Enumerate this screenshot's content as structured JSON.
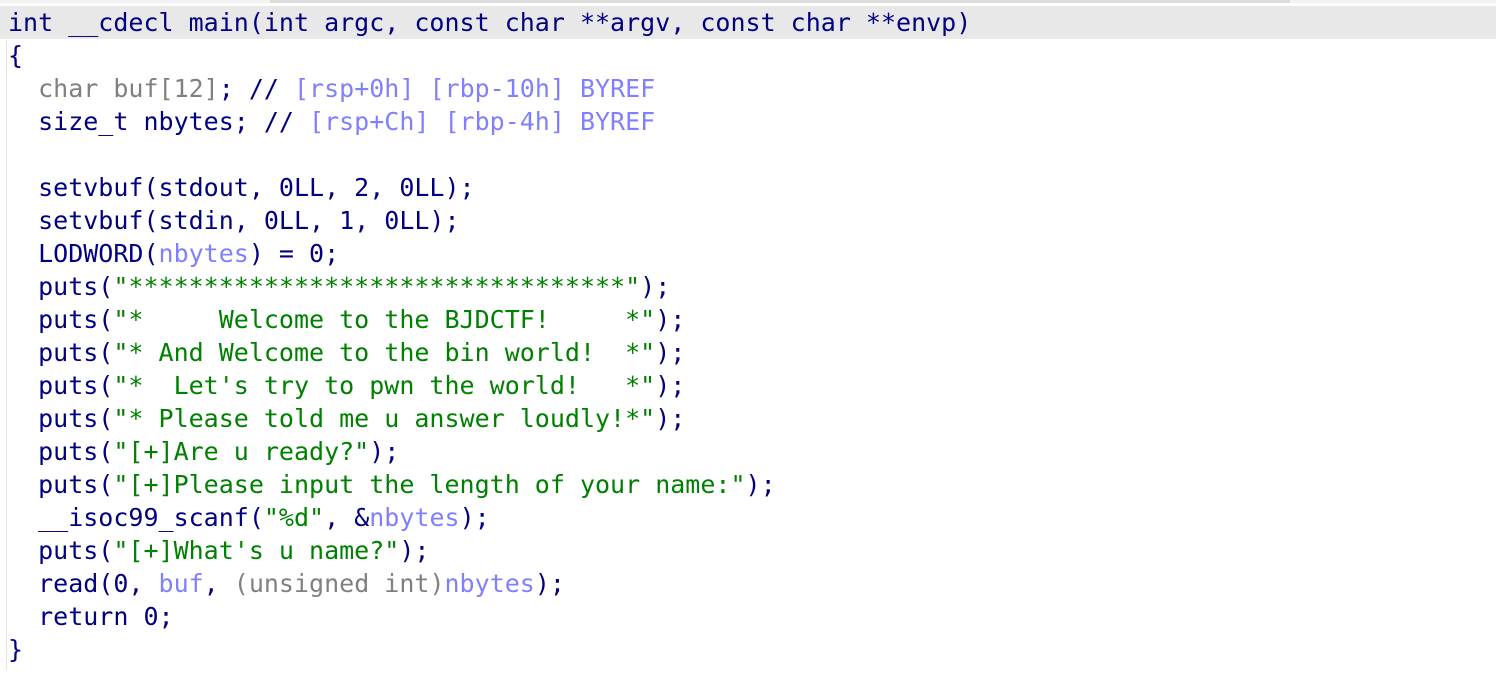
{
  "colors": {
    "identifier": "#000080",
    "comment_dim": "#808080",
    "variable": "#8080ff",
    "string": "#008000",
    "highlight_bg": "#e8e8e8"
  },
  "code_lines": [
    {
      "highlight": true,
      "tokens": [
        {
          "t": "int __cdecl main(int argc, const char **argv, const char **envp)",
          "c": "id"
        }
      ]
    },
    {
      "tokens": [
        {
          "t": "{",
          "c": "id"
        }
      ]
    },
    {
      "tokens": [
        {
          "t": "  char buf",
          "c": "dim"
        },
        {
          "t": "[12]",
          "c": "dim"
        },
        {
          "t": "; // ",
          "c": "id"
        },
        {
          "t": "[rsp+0h] [rbp-10h] BYREF",
          "c": "var"
        }
      ]
    },
    {
      "tokens": [
        {
          "t": "  size_t nbytes; // ",
          "c": "id"
        },
        {
          "t": "[rsp+Ch] [rbp-4h] BYREF",
          "c": "var"
        }
      ]
    },
    {
      "tokens": [
        {
          "t": "",
          "c": "id"
        }
      ]
    },
    {
      "tokens": [
        {
          "t": "  setvbuf(stdout, 0LL, 2, 0LL);",
          "c": "id"
        }
      ]
    },
    {
      "tokens": [
        {
          "t": "  setvbuf(stdin, 0LL, 1, 0LL);",
          "c": "id"
        }
      ]
    },
    {
      "tokens": [
        {
          "t": "  LODWORD(",
          "c": "id"
        },
        {
          "t": "nbytes",
          "c": "var"
        },
        {
          "t": ") = 0;",
          "c": "id"
        }
      ]
    },
    {
      "tokens": [
        {
          "t": "  puts(",
          "c": "id"
        },
        {
          "t": "\"*********************************\"",
          "c": "str"
        },
        {
          "t": ");",
          "c": "id"
        }
      ]
    },
    {
      "tokens": [
        {
          "t": "  puts(",
          "c": "id"
        },
        {
          "t": "\"*     Welcome to the BJDCTF!     *\"",
          "c": "str"
        },
        {
          "t": ");",
          "c": "id"
        }
      ]
    },
    {
      "tokens": [
        {
          "t": "  puts(",
          "c": "id"
        },
        {
          "t": "\"* And Welcome to the bin world!  *\"",
          "c": "str"
        },
        {
          "t": ");",
          "c": "id"
        }
      ]
    },
    {
      "tokens": [
        {
          "t": "  puts(",
          "c": "id"
        },
        {
          "t": "\"*  Let's try to pwn the world!   *\"",
          "c": "str"
        },
        {
          "t": ");",
          "c": "id"
        }
      ]
    },
    {
      "tokens": [
        {
          "t": "  puts(",
          "c": "id"
        },
        {
          "t": "\"* Please told me u answer loudly!*\"",
          "c": "str"
        },
        {
          "t": ");",
          "c": "id"
        }
      ]
    },
    {
      "tokens": [
        {
          "t": "  puts(",
          "c": "id"
        },
        {
          "t": "\"[+]Are u ready?\"",
          "c": "str"
        },
        {
          "t": ");",
          "c": "id"
        }
      ]
    },
    {
      "tokens": [
        {
          "t": "  puts(",
          "c": "id"
        },
        {
          "t": "\"[+]Please input the length of your name:\"",
          "c": "str"
        },
        {
          "t": ");",
          "c": "id"
        }
      ]
    },
    {
      "tokens": [
        {
          "t": "  __isoc99_scanf(",
          "c": "id"
        },
        {
          "t": "\"%d\"",
          "c": "str"
        },
        {
          "t": ", &",
          "c": "id"
        },
        {
          "t": "nbytes",
          "c": "var"
        },
        {
          "t": ");",
          "c": "id"
        }
      ]
    },
    {
      "tokens": [
        {
          "t": "  puts(",
          "c": "id"
        },
        {
          "t": "\"[+]What's u name?\"",
          "c": "str"
        },
        {
          "t": ");",
          "c": "id"
        }
      ]
    },
    {
      "tokens": [
        {
          "t": "  read(0, ",
          "c": "id"
        },
        {
          "t": "buf",
          "c": "var"
        },
        {
          "t": ", ",
          "c": "id"
        },
        {
          "t": "(unsigned int)",
          "c": "dim"
        },
        {
          "t": "nbytes",
          "c": "var"
        },
        {
          "t": ");",
          "c": "id"
        }
      ]
    },
    {
      "tokens": [
        {
          "t": "  return 0;",
          "c": "id"
        }
      ]
    },
    {
      "tokens": [
        {
          "t": "}",
          "c": "id"
        }
      ]
    }
  ]
}
